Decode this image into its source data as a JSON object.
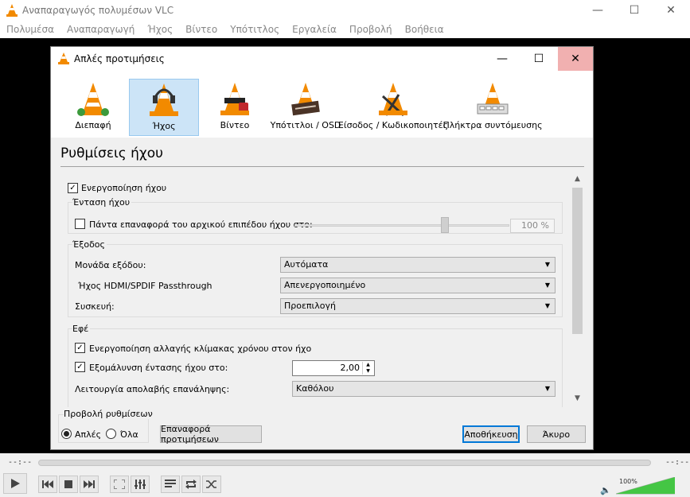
{
  "window": {
    "title": "Αναπαραγωγός πολυμέσων VLC",
    "controls": {
      "minimize": "—",
      "maximize": "☐",
      "close": "✕"
    }
  },
  "menubar": [
    "Πολυμέσα",
    "Αναπαραγωγή",
    "Ήχος",
    "Βίντεο",
    "Υπότιτλος",
    "Εργαλεία",
    "Προβολή",
    "Βοήθεια"
  ],
  "player": {
    "time_elapsed": "--:--",
    "time_total": "--:--",
    "volume": "100%",
    "volume_level": 1.0
  },
  "dialog": {
    "title": "Απλές προτιμήσεις",
    "categories": [
      {
        "id": "interface",
        "label": "Διεπαφή",
        "selected": false
      },
      {
        "id": "audio",
        "label": "Ήχος",
        "selected": true
      },
      {
        "id": "video",
        "label": "Βίντεο",
        "selected": false
      },
      {
        "id": "subtitles",
        "label": "Υπότιτλοι / OSD",
        "selected": false
      },
      {
        "id": "input",
        "label": "Είσοδος / Κωδικοποιητές",
        "selected": false
      },
      {
        "id": "hotkeys",
        "label": "Πλήκτρα συντόμευσης",
        "selected": false
      }
    ],
    "section_title": "Ρυθμίσεις ήχου",
    "enable_audio": {
      "label": "Ενεργοποίηση ήχου",
      "checked": true
    },
    "volume_group": {
      "title": "Ένταση ήχου",
      "always_reset": {
        "label": "Πάντα επαναφορά του αρχικού επιπέδου ήχου στο:",
        "checked": false
      },
      "value": "100 %",
      "slider_level": 0.68
    },
    "output_group": {
      "title": "Έξοδος",
      "module_label": "Μονάδα εξόδου:",
      "module_value": "Αυτόματα",
      "hdmi_label": "Ήχος HDMI/SPDIF Passthrough",
      "hdmi_value": "Απενεργοποιημένο",
      "device_label": "Συσκευή:",
      "device_value": "Προεπιλογή"
    },
    "effects_group": {
      "title": "Εφέ",
      "time_stretch": {
        "label": "Ενεργοποίηση αλλαγής κλίμακας χρόνου στον ήχο",
        "checked": true
      },
      "normalize": {
        "label": "Εξομάλυνση έντασης ήχου στο:",
        "checked": true
      },
      "normalize_value": "2,00",
      "replay_gain_label": "Λειτουργία απολαβής επανάληψης:",
      "replay_gain_value": "Καθόλου"
    },
    "show_settings": {
      "title": "Προβολή ρυθμίσεων",
      "simple_label": "Απλές",
      "all_label": "Όλα",
      "selected": "simple"
    },
    "buttons": {
      "reset": "Επαναφορά προτιμήσεων",
      "save": "Αποθήκευση",
      "cancel": "Άκυρο"
    }
  }
}
